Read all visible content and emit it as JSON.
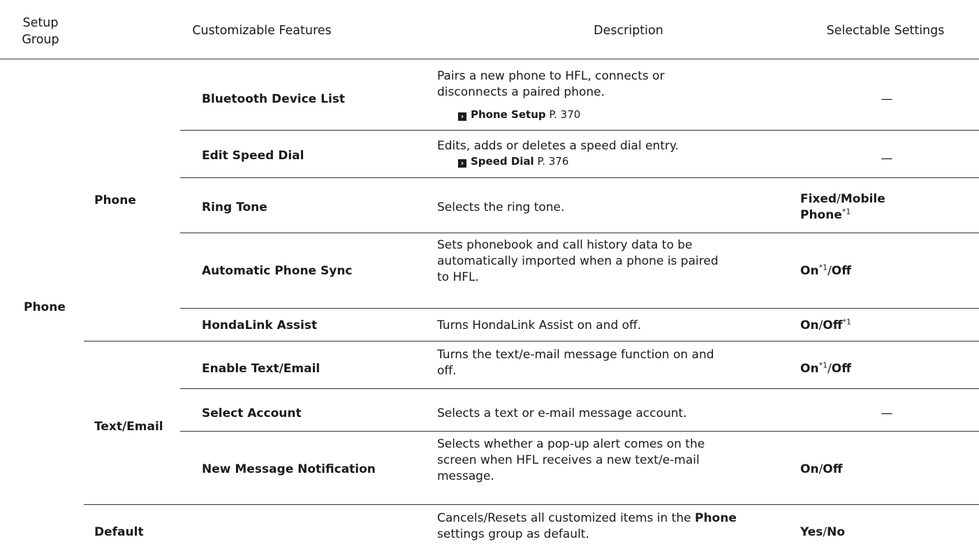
{
  "header": {
    "setup_group": "Setup\nGroup",
    "features": "Customizable Features",
    "description": "Description",
    "settings": "Selectable Settings"
  },
  "group_label": "Phone",
  "subgroups": {
    "phone": "Phone",
    "text_email": "Text/Email",
    "default": "Default"
  },
  "rows": [
    {
      "feature": "Bluetooth Device List",
      "description": "Pairs a new phone to HFL, connects or\ndisconnects a paired phone.",
      "ref_title": "Phone Setup",
      "ref_page": "P. 370",
      "setting": "—"
    },
    {
      "feature": "Edit Speed Dial",
      "description": "Edits, adds or deletes a speed dial entry.",
      "ref_title": "Speed Dial",
      "ref_page": "P. 376",
      "setting": "—"
    },
    {
      "feature": "Ring Tone",
      "description": "Selects the ring tone.",
      "setting_a": "Fixed",
      "setting_sep": "/",
      "setting_b": "Mobile",
      "setting_b2": "Phone",
      "note": "*1"
    },
    {
      "feature": "Automatic Phone Sync",
      "description": "Sets phonebook and call history data to be\nautomatically imported when a phone is paired\nto HFL.",
      "setting_a": "On",
      "note": "*1",
      "setting_sep": "/",
      "setting_b": "Off"
    },
    {
      "feature": "HondaLink Assist",
      "description": "Turns HondaLink Assist on and off.",
      "setting_a": "On",
      "setting_sep": "/",
      "setting_b": "Off",
      "note": "*1"
    },
    {
      "feature": "Enable Text/Email",
      "description": "Turns the text/e-mail message function on and\noff.",
      "setting_a": "On",
      "note": "*1",
      "setting_sep": "/",
      "setting_b": "Off"
    },
    {
      "feature": "Select Account",
      "description": "Selects a text or e-mail message account.",
      "setting": "—"
    },
    {
      "feature": "New Message Notification",
      "description": "Selects whether a pop-up alert comes on the\nscreen when HFL receives a new text/e-mail\nmessage.",
      "setting_a": "On",
      "setting_sep": "/",
      "setting_b": "Off"
    },
    {
      "description_a": "Cancels/Resets all customized items in the ",
      "description_bold": "Phone",
      "description_b": "settings group as default.",
      "setting_a": "Yes",
      "setting_sep": "/",
      "setting_b": "No"
    }
  ]
}
